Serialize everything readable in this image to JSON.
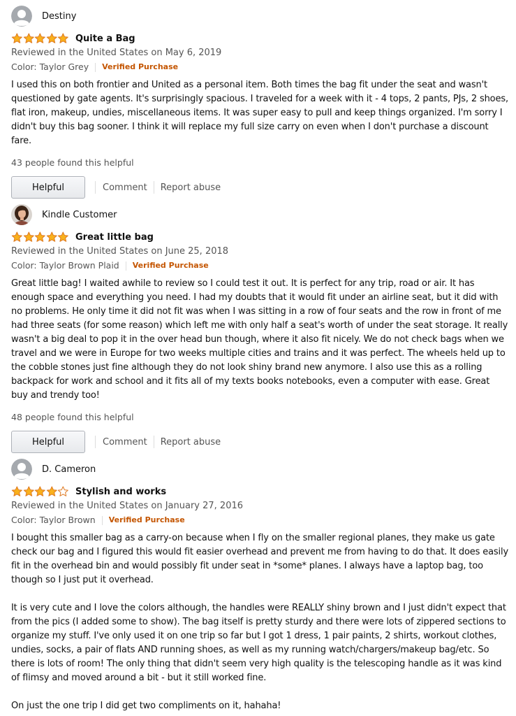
{
  "colors": {
    "star_fill": "#f9b11c",
    "star_stroke": "#de7921",
    "verified": "#c45500",
    "muted_text": "#555555"
  },
  "reviews": [
    {
      "author": "Destiny",
      "avatar": "default-user-avatar",
      "stars": 5,
      "title": "Quite a Bag",
      "date": "Reviewed in the United States on May 6, 2019",
      "color": "Color: Taylor Grey",
      "verified": "Verified Purchase",
      "paragraphs": [
        "I used this on both frontier and United as a personal item. Both times the bag fit under the seat and wasn't questioned by gate agents. It's surprisingly spacious. I traveled for a week with it - 4 tops, 2 pants, PJs, 2 shoes, flat iron, makeup, undies, miscellaneous items. It was super easy to pull and keep things organized. I'm sorry I didn't buy this bag sooner. I think it will replace my full size carry on even when I don't purchase a discount fare."
      ],
      "helpful_count": "43 people found this helpful",
      "helpful_label": "Helpful",
      "comment_label": "Comment",
      "report_label": "Report abuse"
    },
    {
      "author": "Kindle Customer",
      "avatar": "photo-avatar",
      "stars": 5,
      "title": "Great little bag",
      "date": "Reviewed in the United States on June 25, 2018",
      "color": "Color: Taylor Brown Plaid",
      "verified": "Verified Purchase",
      "paragraphs": [
        "Great little bag! I waited awhile to review so I could test it out. It is perfect for any trip, road or air. It has enough space and everything you need. I had my doubts that it would fit under an airline seat, but it did with no problems. He only time it did not fit was when I was sitting in a row of four seats and the row in front of me had three seats (for some reason) which left me with only half a seat's worth of under the seat storage. It really wasn't a big deal to pop it in the over head bun though, where it also fit nicely. We do not check bags when we travel and we were in Europe for two weeks multiple cities and trains and it was perfect. The wheels held up to the cobble stones just fine although they do not look shiny brand new anymore. I also use this as a rolling backpack for work and school and it fits all of my texts books notebooks, even a computer with ease. Great buy and trendy too!"
      ],
      "helpful_count": "48 people found this helpful",
      "helpful_label": "Helpful",
      "comment_label": "Comment",
      "report_label": "Report abuse"
    },
    {
      "author": "D. Cameron",
      "avatar": "default-user-avatar",
      "stars": 4,
      "title": "Stylish and works",
      "date": "Reviewed in the United States on January 27, 2016",
      "color": "Color: Taylor Brown",
      "verified": "Verified Purchase",
      "paragraphs": [
        "I bought this smaller bag as a carry-on because when I fly on the smaller regional planes, they make us gate check our bag and I figured this would fit easier overhead and prevent me from having to do that. It does easily fit in the overhead bin and would possibly fit under seat in *some* planes. I always have a laptop bag, too though so I just put it overhead.",
        "It is very cute and I love the colors although, the handles were REALLY shiny brown and I just didn't expect that from the pics (I added some to show). The bag itself is pretty sturdy and there were lots of zippered sections to organize my stuff. I've only used it on one trip so far but I got 1 dress, 1 pair paints, 2 shirts, workout clothes, undies, socks, a pair of flats AND running shoes, as well as my running watch/chargers/makeup bag/etc. So there is lots of room! The only thing that didn't seem very high quality is the telescoping handle as it was kind of flimsy and moved around a bit - but it still worked fine.",
        "On just the one trip I did get two compliments on it, hahaha!"
      ]
    }
  ]
}
